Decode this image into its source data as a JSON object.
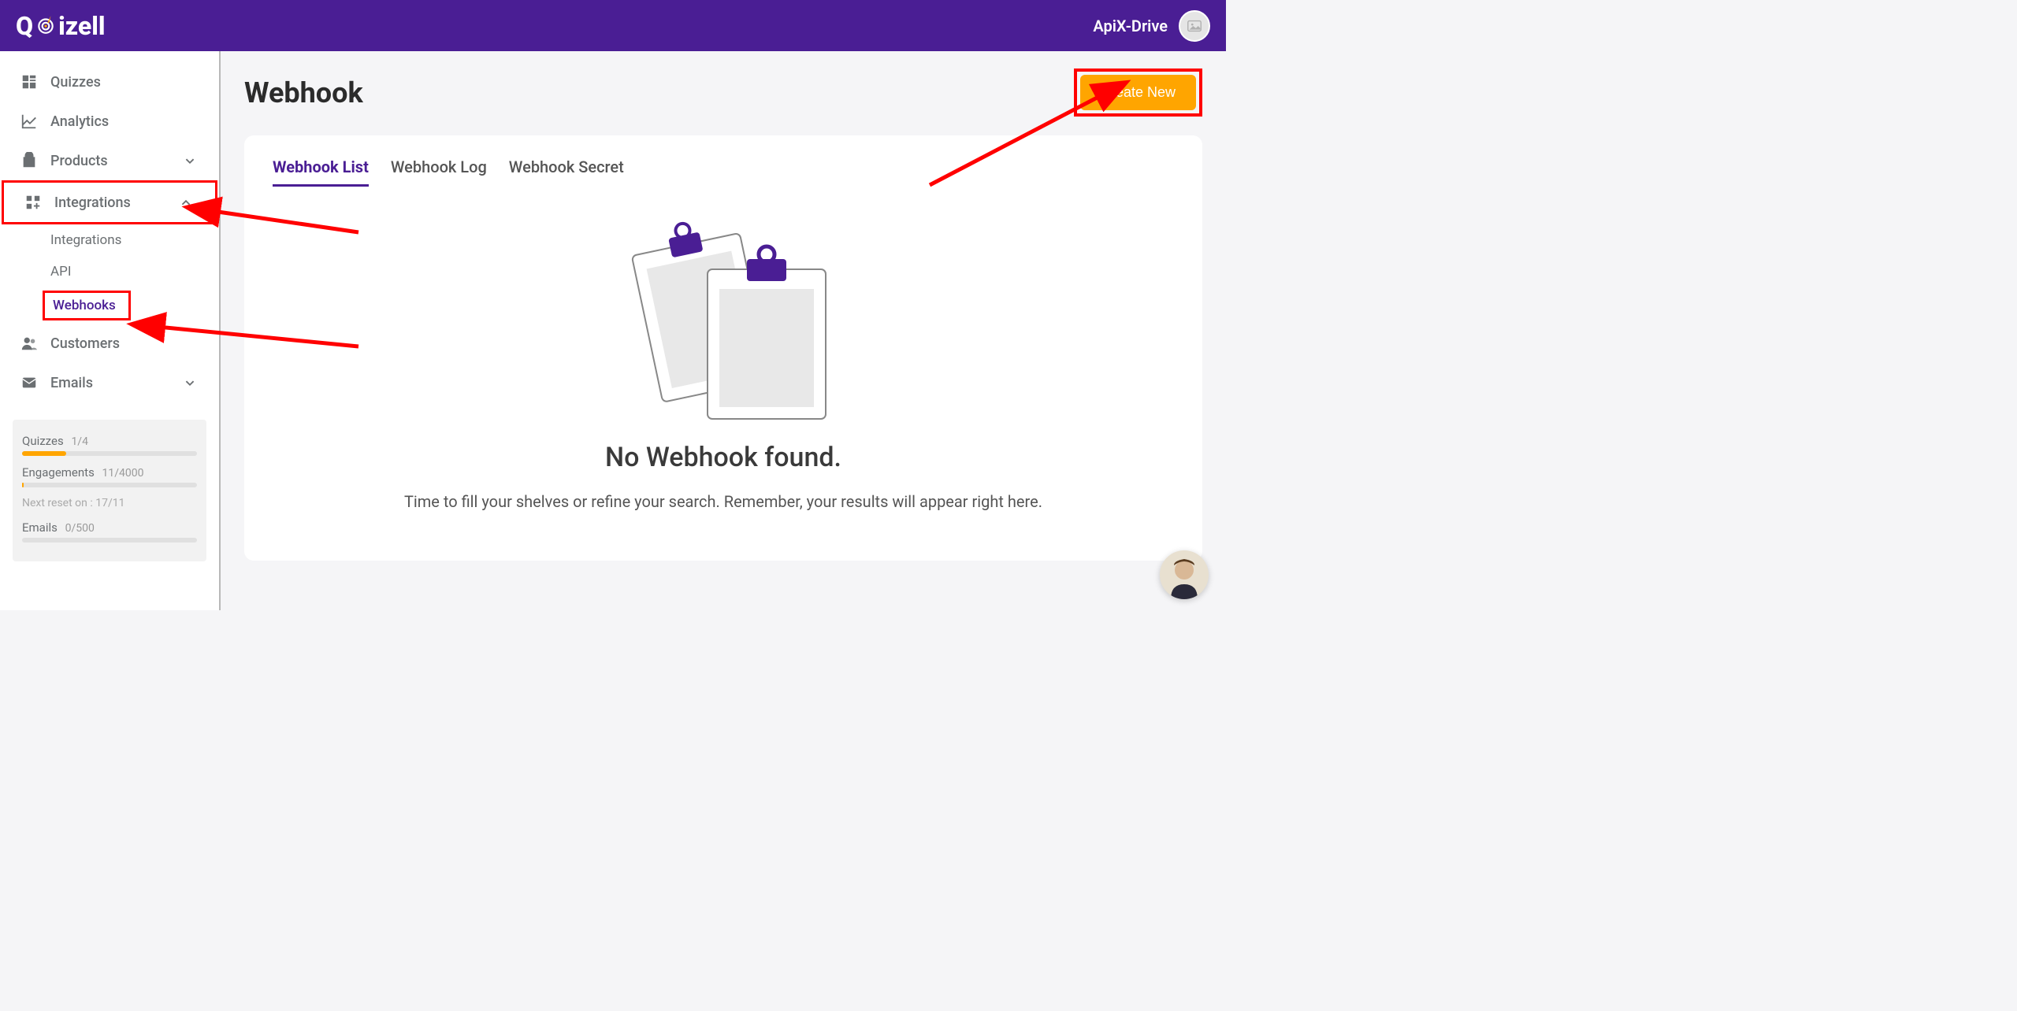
{
  "brand": "Quizell",
  "header": {
    "username": "ApiX-Drive"
  },
  "sidebar": {
    "items": [
      {
        "label": "Quizzes"
      },
      {
        "label": "Analytics"
      },
      {
        "label": "Products"
      },
      {
        "label": "Integrations"
      },
      {
        "label": "Customers"
      },
      {
        "label": "Emails"
      }
    ],
    "integrations_sub": [
      {
        "label": "Integrations"
      },
      {
        "label": "API"
      },
      {
        "label": "Webhooks"
      }
    ]
  },
  "stats": {
    "quizzes_label": "Quizzes",
    "quizzes_val": "1/4",
    "quizzes_pct": 25,
    "engagements_label": "Engagements",
    "engagements_val": "11/4000",
    "engagements_pct": 1,
    "reset_note": "Next reset on : 17/11",
    "emails_label": "Emails",
    "emails_val": "0/500",
    "emails_pct": 0
  },
  "page": {
    "title": "Webhook",
    "create_label": "Create New"
  },
  "tabs": [
    {
      "label": "Webhook List",
      "active": true
    },
    {
      "label": "Webhook Log"
    },
    {
      "label": "Webhook Secret"
    }
  ],
  "empty": {
    "title": "No Webhook found.",
    "subtitle": "Time to fill your shelves or refine your search. Remember, your results will appear right here."
  },
  "colors": {
    "brand_purple": "#4a1e94",
    "accent_orange": "#ffa500",
    "annotation_red": "#ff0000"
  }
}
